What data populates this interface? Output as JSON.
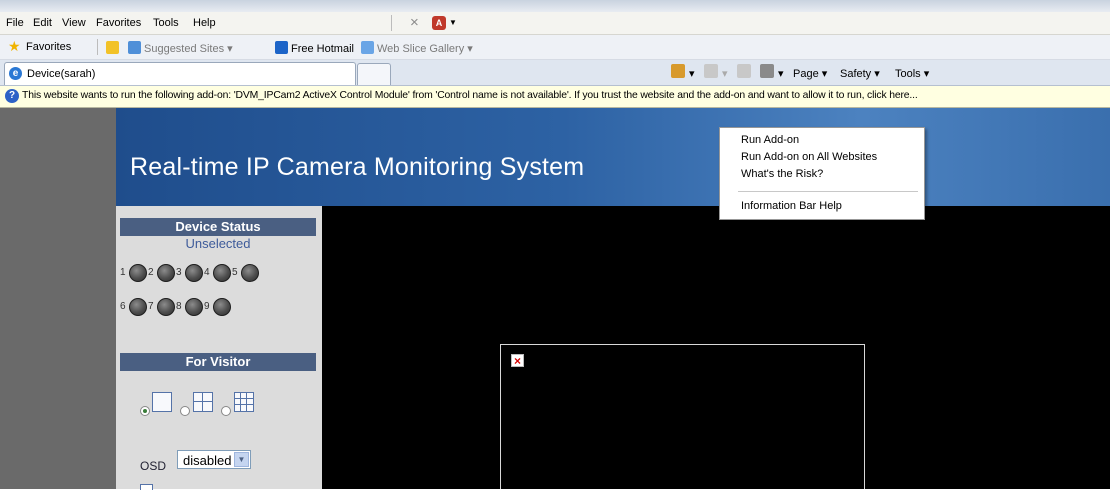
{
  "menubar": {
    "items": [
      "File",
      "Edit",
      "View",
      "Favorites",
      "Tools",
      "Help"
    ],
    "tools": [
      "close-tab-icon",
      "pdf-icon"
    ]
  },
  "favorites_bar": {
    "favorites_label": "Favorites",
    "suggested_sites": "Suggested Sites",
    "free_hotmail": "Free Hotmail",
    "web_slice_gallery": "Web Slice Gallery"
  },
  "tabs": {
    "active_title": "Device(sarah)"
  },
  "command_bar": {
    "page": "Page",
    "safety": "Safety",
    "tools": "Tools"
  },
  "info_bar": {
    "message": "This website wants to run the following add-on: 'DVM_IPCam2 ActiveX Control Module' from 'Control name is not available'. If you trust the website and the add-on and want to allow it to run, click here..."
  },
  "context_menu": {
    "items": [
      "Run Add-on",
      "Run Add-on on All Websites",
      "What's the Risk?"
    ],
    "help": "Information Bar Help"
  },
  "page": {
    "title": "Real-time IP Camera Monitoring System"
  },
  "sidebar": {
    "device_status": {
      "heading": "Device Status",
      "status": "Unselected",
      "channels": [
        "1",
        "2",
        "3",
        "4",
        "5",
        "6",
        "7",
        "8",
        "9"
      ]
    },
    "visitor": {
      "heading": "For Visitor",
      "layouts": [
        "1",
        "4",
        "9"
      ],
      "selected_layout": "1"
    },
    "osd": {
      "label": "OSD",
      "value": "disabled"
    }
  },
  "colors": {
    "header_blue": "#2d62a4",
    "section_head": "#4a5f82",
    "info_bar": "#ffffe1"
  }
}
